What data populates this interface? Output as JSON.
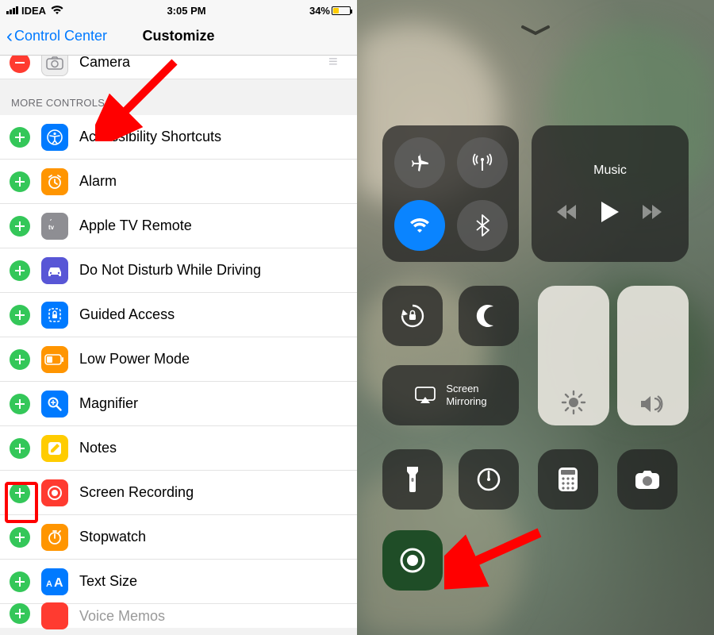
{
  "status": {
    "carrier": "IDEA",
    "time": "3:05 PM",
    "battery_pct": "34%",
    "battery_fill_pct": 34
  },
  "nav": {
    "back_label": "Control Center",
    "title": "Customize"
  },
  "included_partial": {
    "label": "Camera"
  },
  "section_header": "MORE CONTROLS",
  "more": [
    {
      "label": "Accessibility Shortcuts",
      "icon": "accessibility-icon",
      "bg": "#007aff"
    },
    {
      "label": "Alarm",
      "icon": "alarm-icon",
      "bg": "#ff9500"
    },
    {
      "label": "Apple TV Remote",
      "icon": "appletv-icon",
      "bg": "#8e8e93"
    },
    {
      "label": "Do Not Disturb While Driving",
      "icon": "car-icon",
      "bg": "#5856d6"
    },
    {
      "label": "Guided Access",
      "icon": "guided-access-icon",
      "bg": "#007aff"
    },
    {
      "label": "Low Power Mode",
      "icon": "low-power-icon",
      "bg": "#ff9500"
    },
    {
      "label": "Magnifier",
      "icon": "magnifier-icon",
      "bg": "#007aff"
    },
    {
      "label": "Notes",
      "icon": "notes-icon",
      "bg": "#ffcc00"
    },
    {
      "label": "Screen Recording",
      "icon": "record-icon",
      "bg": "#ff3b30"
    },
    {
      "label": "Stopwatch",
      "icon": "stopwatch-icon",
      "bg": "#ff9500"
    },
    {
      "label": "Text Size",
      "icon": "textsize-icon",
      "bg": "#007aff"
    }
  ],
  "cutoff_label": "Voice Memos",
  "control_center": {
    "music_label": "Music",
    "mirror_label": "Screen\nMirroring"
  }
}
